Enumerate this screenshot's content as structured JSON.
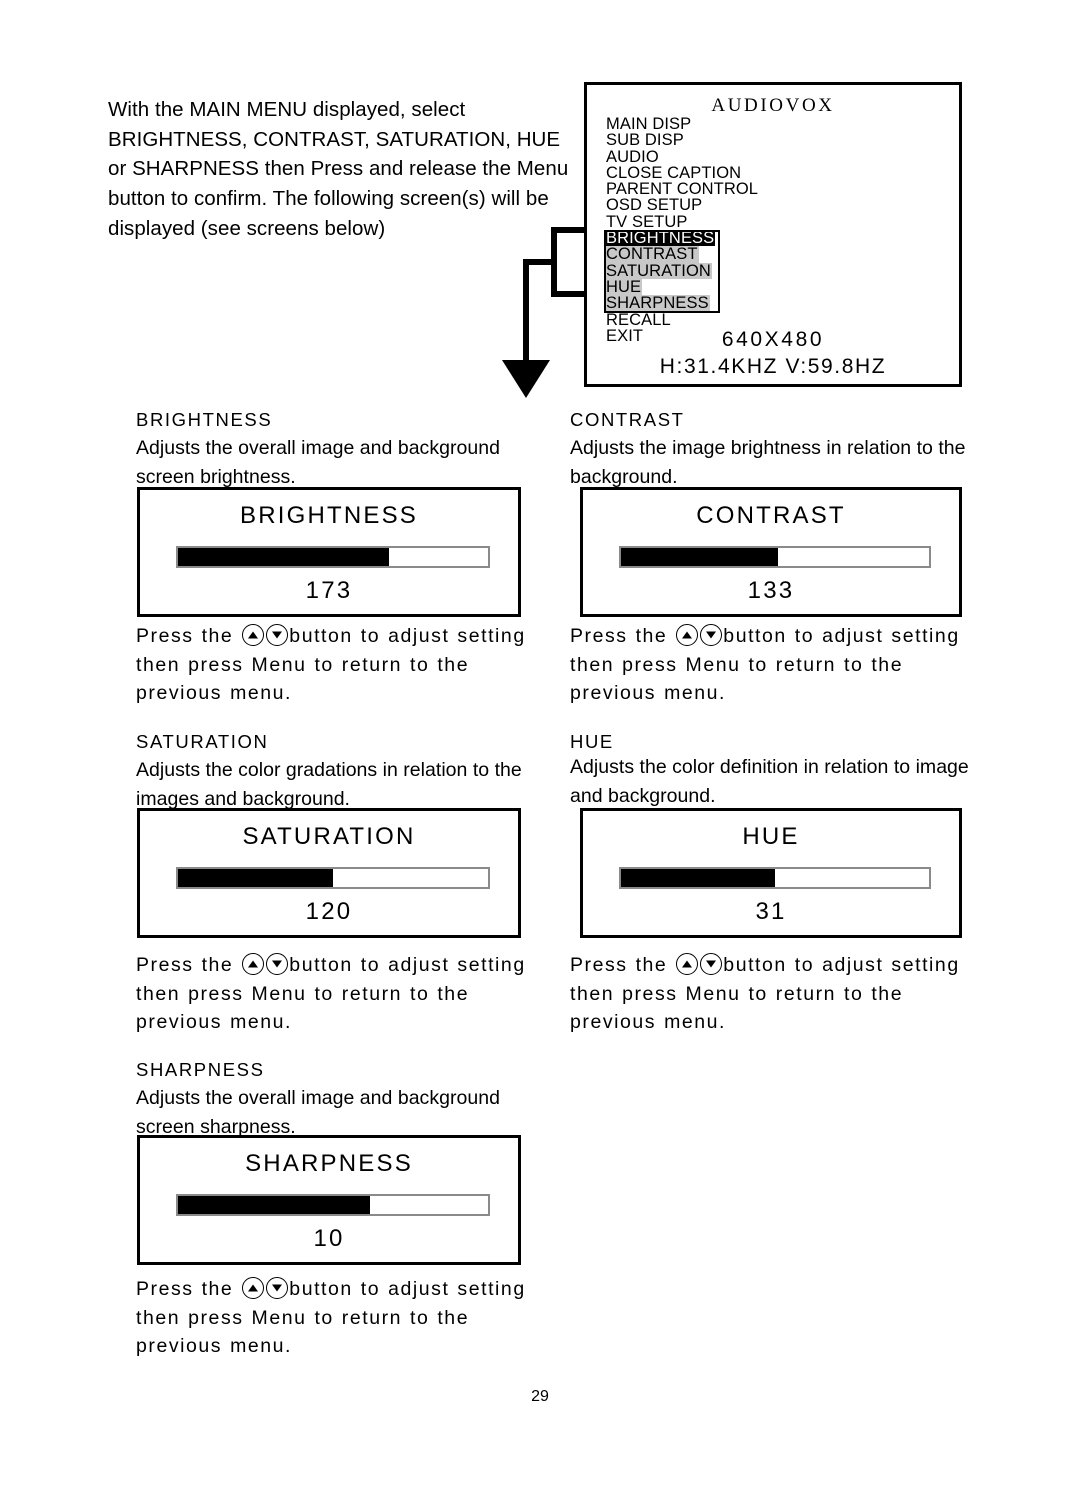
{
  "intro": {
    "text": "With the MAIN MENU displayed, select BRIGHTNESS, CONTRAST, SATURATION, HUE or SHARPNESS then Press and release the Menu button to confirm. The following screen(s) will be displayed (see screens below)"
  },
  "osd": {
    "brand": "AUDIOVOX",
    "items": [
      {
        "label": "MAIN DISP",
        "state": "normal"
      },
      {
        "label": "SUB DISP",
        "state": "normal"
      },
      {
        "label": "AUDIO",
        "state": "normal"
      },
      {
        "label": "CLOSE CAPTION",
        "state": "normal"
      },
      {
        "label": "PARENT CONTROL",
        "state": "normal"
      },
      {
        "label": "OSD SETUP",
        "state": "normal"
      },
      {
        "label": "TV SETUP",
        "state": "normal"
      },
      {
        "label": "BRIGHTNESS",
        "state": "selected"
      },
      {
        "label": "CONTRAST",
        "state": "grouped"
      },
      {
        "label": "SATURATION",
        "state": "grouped"
      },
      {
        "label": "HUE",
        "state": "grouped"
      },
      {
        "label": "SHARPNESS",
        "state": "grouped"
      },
      {
        "label": "RECALL",
        "state": "normal"
      },
      {
        "label": "EXIT",
        "state": "normal"
      }
    ],
    "resolution": "640X480",
    "frequency": "H:31.4KHZ V:59.8HZ",
    "selected_bg": "#000000",
    "group_bg": "#c8c8c8"
  },
  "sections": [
    {
      "id": "brightness",
      "heading": "BRIGHTNESS",
      "description": "Adjusts the overall image and background screen brightness.",
      "panel_title": "BRIGHTNESS",
      "value": "173",
      "fill_percent": 68,
      "instruction_pre": "Press the",
      "instruction_post": "button to adjust setting then press Menu to return to the previous menu."
    },
    {
      "id": "contrast",
      "heading": "CONTRAST",
      "description": "Adjusts the image brightness in relation to the background.",
      "panel_title": "CONTRAST",
      "value": "133",
      "fill_percent": 51,
      "instruction_pre": "Press the",
      "instruction_post": "button to adjust setting then press Menu to return to the previous menu."
    },
    {
      "id": "saturation",
      "heading": "SATURATION",
      "description": "Adjusts the color gradations in relation to the images and background.",
      "panel_title": "SATURATION",
      "value": "120",
      "fill_percent": 50,
      "instruction_pre": "Press the",
      "instruction_post": "button to adjust setting then press Menu to return to the previous menu."
    },
    {
      "id": "hue",
      "heading": "HUE",
      "description": "Adjusts the color definition in relation to image and background.",
      "panel_title": "HUE",
      "value": "31",
      "fill_percent": 50,
      "instruction_pre": "Press the",
      "instruction_post": "button to adjust setting then press Menu to return to the previous menu."
    },
    {
      "id": "sharpness",
      "heading": "SHARPNESS",
      "description": "Adjusts the overall image and background screen sharpness.",
      "panel_title": "SHARPNESS",
      "value": "10",
      "fill_percent": 62,
      "instruction_pre": "Press the",
      "instruction_post": "button to adjust setting then press Menu to return to the previous menu."
    }
  ],
  "page_number": "29"
}
